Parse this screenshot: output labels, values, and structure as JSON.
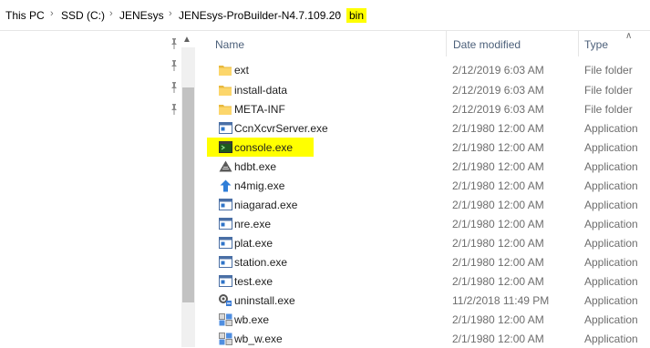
{
  "breadcrumb": {
    "items": [
      "This PC",
      "SSD (C:)",
      "JENEsys",
      "JENEsys-ProBuilder-N4.7.109.20",
      "bin"
    ],
    "highlight_color": "#ffff00"
  },
  "columns": {
    "name": "Name",
    "date_modified": "Date modified",
    "type": "Type"
  },
  "files": [
    {
      "name": "ext",
      "date": "2/12/2019 6:03 AM",
      "type": "File folder",
      "icon": "folder-icon"
    },
    {
      "name": "install-data",
      "date": "2/12/2019 6:03 AM",
      "type": "File folder",
      "icon": "folder-icon"
    },
    {
      "name": "META-INF",
      "date": "2/12/2019 6:03 AM",
      "type": "File folder",
      "icon": "folder-icon"
    },
    {
      "name": "CcnXcvrServer.exe",
      "date": "2/1/1980 12:00 AM",
      "type": "Application",
      "icon": "application-window-icon"
    },
    {
      "name": "console.exe",
      "date": "2/1/1980 12:00 AM",
      "type": "Application",
      "icon": "console-icon",
      "highlighted": true
    },
    {
      "name": "hdbt.exe",
      "date": "2/1/1980 12:00 AM",
      "type": "Application",
      "icon": "triangle-app-icon"
    },
    {
      "name": "n4mig.exe",
      "date": "2/1/1980 12:00 AM",
      "type": "Application",
      "icon": "up-arrow-icon"
    },
    {
      "name": "niagarad.exe",
      "date": "2/1/1980 12:00 AM",
      "type": "Application",
      "icon": "application-window-icon"
    },
    {
      "name": "nre.exe",
      "date": "2/1/1980 12:00 AM",
      "type": "Application",
      "icon": "application-window-icon"
    },
    {
      "name": "plat.exe",
      "date": "2/1/1980 12:00 AM",
      "type": "Application",
      "icon": "application-window-icon"
    },
    {
      "name": "station.exe",
      "date": "2/1/1980 12:00 AM",
      "type": "Application",
      "icon": "application-window-icon"
    },
    {
      "name": "test.exe",
      "date": "2/1/1980 12:00 AM",
      "type": "Application",
      "icon": "application-window-icon"
    },
    {
      "name": "uninstall.exe",
      "date": "11/2/2018 11:49 PM",
      "type": "Application",
      "icon": "uninstall-gear-icon"
    },
    {
      "name": "wb.exe",
      "date": "2/1/1980 12:00 AM",
      "type": "Application",
      "icon": "workbench-icon"
    },
    {
      "name": "wb_w.exe",
      "date": "2/1/1980 12:00 AM",
      "type": "Application",
      "icon": "workbench-icon"
    }
  ],
  "icons": {
    "breadcrumb_separator": "chevron-right-icon",
    "pin": "pin-icon",
    "scroll_up": "scroll-up-arrow-icon",
    "sort": "sort-caret-up-icon"
  }
}
